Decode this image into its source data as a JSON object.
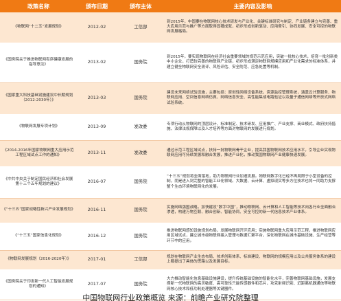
{
  "table": {
    "headers": [
      "政策名称",
      "颁布日期",
      "颁布主体",
      "主要内容及影响"
    ],
    "rows": [
      {
        "name": "《物联网“十二五”发展规划》",
        "date": "2012-02",
        "issuer": "工信部",
        "content": "到2015年，中国要在物联网核心技术研发与产业化、关键标准研究与制定、产业链条建立与完善、重大应用示范与推广等方面取得显著成就，初步形成创新驱动、应用牵引、协同发展、安全可控的物联网发展格局。"
      },
      {
        "name": "《国务院关于推进物联网有序健康发展的指导意见》",
        "date": "2013-02",
        "issuer": "国务院",
        "content": "到2015年，要实现物联网在经济社会重要领域的规范示范应用，突破一批核心技术，培育一批创新类中小企业，打造较完善的物联网产业链，初步形成满足物联网规模应用和产业化需求的标准体系，并建立健全物联网安全测评、风险评估、安全防范、应急处置等机制。"
      },
      {
        "name": "《国家重大科技基础设施建设中长期规划（2012-2030年）》",
        "date": "2013-03",
        "issuer": "国务院",
        "content": "建设未来网络试验设施，主要包括：原创性网络设备系统，资源监控管理系统，涵盖云计算服务、物联网应用、空间信息网络仿真、网络信息安全、高性能集成电路验证以及量子通信网络等开放式网络试验系统。"
      },
      {
        "name": "《物联网发展专项计划》",
        "date": "2013-09",
        "issuer": "发改委",
        "content": "专项行动从物联网的顶层设计、标准制定、技术研发、应用推广、产业支撑、商业模式、政府扶持措施、法律法规保障以及人才培养等方面对物联网的发展进行规划。"
      },
      {
        "name": "《2014-2016年国家物联网重大应用示范工程区域试点工作的通知》",
        "date": "2013-11",
        "issuer": "发改委",
        "content": "通过示范工程区域试点，扶持一批物联网骨干企业，提高我国物联网技术应用水平，引导企业实现物联网应用可持续发展和融合发展，推进产业化，推动我国物联网产业健康快速发展。"
      },
      {
        "name": "《中共中央关于制定国民经济和社会发展第十三个五年规划的建议》",
        "date": "2016-07",
        "issuer": "国务院",
        "content": "“十三五”规划将全面落地，助力物联网行业加速发展。物联网数字化已经不再局限于小型设备的控制，而是进入到完整的智能工业化领域。大数据、云计算、虚拟现实等多方位技术也将一同助力支撑整个生态环境物联网化的发展。"
      },
      {
        "name": "《“十三五”国家战略性新兴产业发展规划》",
        "date": "2016-11",
        "issuer": "国务院",
        "content": "实施网络强国战略，加快建设“数字中国”，推动物联网、云计算和人工智能等技术向各行业全面融合渗透，构建万物互联、融合创新、智能协同、安全可控的新一代信息技术产业体系。"
      },
      {
        "name": "《“十三五”国家信息化规划》",
        "date": "2016-12",
        "issuer": "国务院",
        "content": "推进物联网感知设施规划布局，发展物联网开环应用；实施物联网重大应用示范工程，推进物联网应用区域试点，建立城市级物联网接入管理与数据汇聚平台，深化物联网在城市基础设施、生产经营等环节中的应用。"
      },
      {
        "name": "《物联网发展规划（2016-2020年）》",
        "date": "2017-01",
        "issuer": "工信部",
        "content": "规划在物联网产业生态布局、技术创新体系、标准建设、物联网的规模应用以及公共服务体系的建设上都提出了具体的思路以及发展目标。"
      },
      {
        "name": "《国务院关于印发新一代人工智能发展规划的通知》",
        "date": "2017-07",
        "issuer": "国务院",
        "content": "大力推动智能化信息基础设施建设，提升传统基础设施的智能化水平，完善物联网基础设施，发展支撑新一代物联网的高灵敏度、高可靠性只能传感器件和芯片，攻克射频识别、近距离机器通信等物联网核心技术和低功耗处理器等关键器件。"
      }
    ]
  },
  "caption": "中国物联网行业政策概览 来源：前瞻产业研究院整理"
}
